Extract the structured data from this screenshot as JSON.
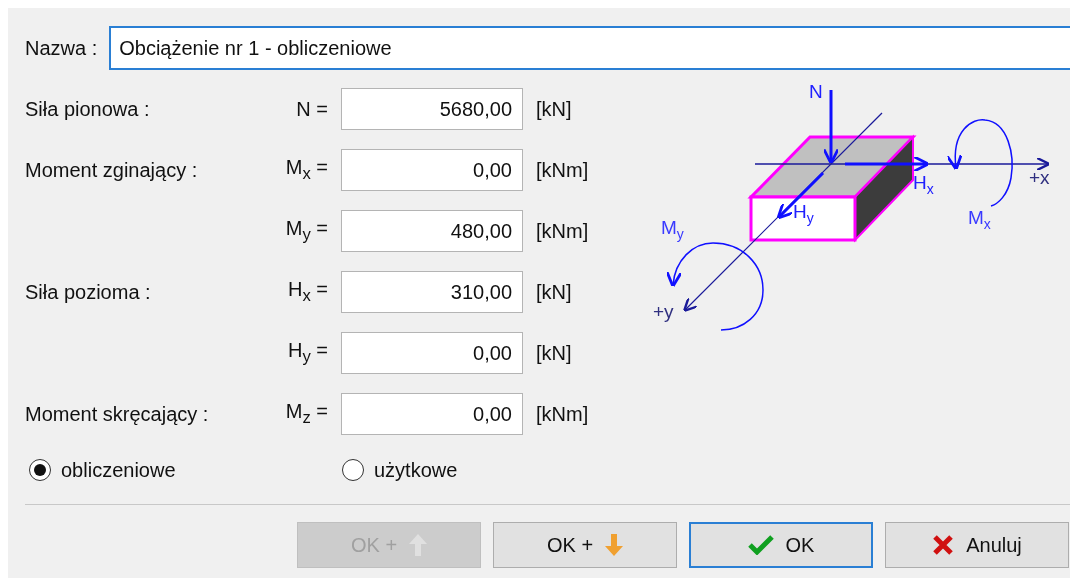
{
  "name_field": {
    "label": "Nazwa :",
    "value": "Obciążenie nr 1 - obliczeniowe",
    "focused": true
  },
  "rows": [
    {
      "label": "Siła pionowa :",
      "symbol": "N =",
      "value": "5680,00",
      "unit": "[kN]"
    },
    {
      "label": "Moment zginający :",
      "symbol": "M$_{x}$ =",
      "value": "0,00",
      "unit": "[kNm]"
    },
    {
      "symbol": "M$_{y}$ =",
      "value": "480,00",
      "unit": "[kNm]"
    },
    {
      "label": "Siła pozioma :",
      "symbol": "H$_{x}$ =",
      "value": "310,00",
      "unit": "[kN]"
    },
    {
      "symbol": "H$_{y}$ =",
      "value": "0,00",
      "unit": "[kN]"
    },
    {
      "label": "Moment skręcający :",
      "symbol": "M$_{z}$ =",
      "value": "0,00",
      "unit": "[kNm]"
    }
  ],
  "diagram": {
    "labels": [
      {
        "text": "N",
        "kind": "force"
      },
      {
        "text": "H$_{x}$",
        "kind": "force"
      },
      {
        "text": "+x",
        "kind": "axis"
      },
      {
        "text": "M$_{x}$",
        "kind": "moment"
      },
      {
        "text": "H$_{y}$",
        "kind": "force"
      },
      {
        "text": "M$_{y}$",
        "kind": "moment"
      },
      {
        "text": "+y",
        "kind": "axis"
      }
    ]
  },
  "load_type": [
    {
      "label": "obliczeniowe",
      "selected": true
    },
    {
      "label": "użytkowe",
      "selected": false
    }
  ],
  "buttons": [
    {
      "label": "OK +",
      "kind": "add-up",
      "disabled": true,
      "default": false
    },
    {
      "label": "OK +",
      "kind": "add-down",
      "disabled": false,
      "default": false
    },
    {
      "label": "OK",
      "kind": "confirm",
      "disabled": false,
      "default": true
    },
    {
      "label": "Anuluj",
      "kind": "cancel",
      "disabled": false,
      "default": false
    }
  ]
}
